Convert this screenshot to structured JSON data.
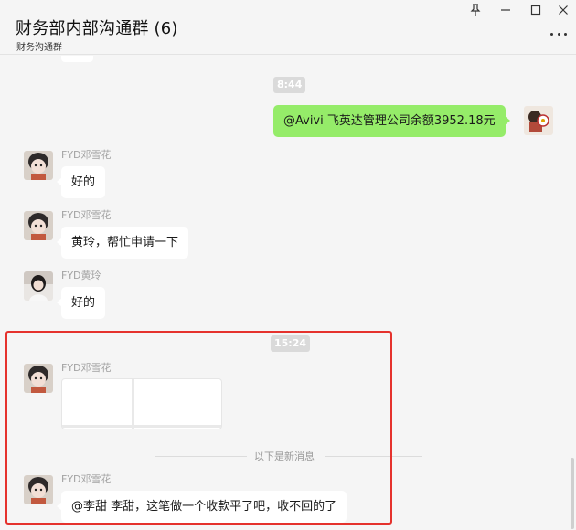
{
  "header": {
    "title": "财务部内部沟通群 (6)",
    "subtitle": "财务沟通群"
  },
  "window_controls": {
    "pin_icon": "pin-icon",
    "minimize_icon": "minimize-icon",
    "maximize_icon": "maximize-icon",
    "close_icon": "close-icon",
    "more_icon": "more-icon"
  },
  "messages": [
    {
      "type": "time",
      "text": "8:44"
    },
    {
      "type": "outgoing",
      "text": "@Avivi 飞英达管理公司余额3952.18元"
    },
    {
      "type": "incoming",
      "sender": "FYD邓雪花",
      "text": "好的"
    },
    {
      "type": "incoming",
      "sender": "FYD邓雪花",
      "text": "黄玲，帮忙申请一下"
    },
    {
      "type": "incoming",
      "sender": "FYD黄玲",
      "text": "好的"
    },
    {
      "type": "time",
      "text": "15:24"
    },
    {
      "type": "incoming-card",
      "sender": "FYD邓雪花"
    },
    {
      "type": "divider",
      "text": "以下是新消息"
    },
    {
      "type": "incoming",
      "sender": "FYD邓雪花",
      "text": "@李甜 李甜，这笔做一个收款平了吧，收不回的了"
    }
  ],
  "colors": {
    "self_bubble": "#95ec69",
    "highlight_border": "#e5322d"
  }
}
